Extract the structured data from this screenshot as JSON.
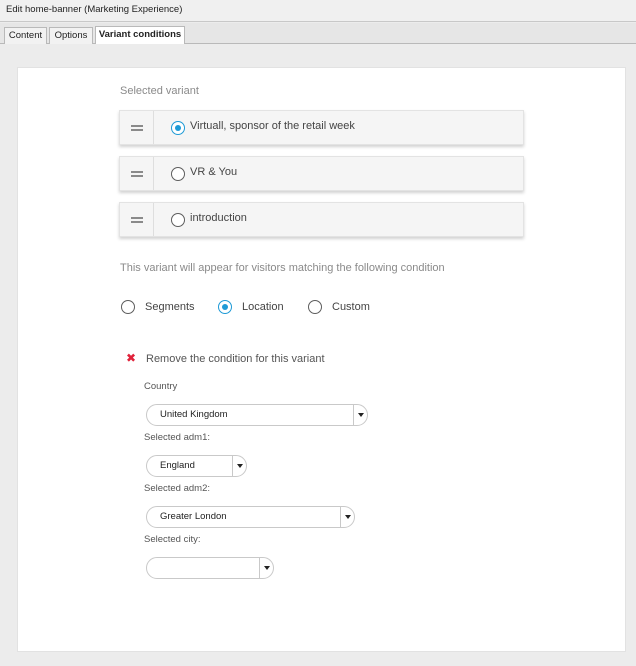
{
  "window": {
    "title": "Edit home-banner (Marketing Experience)"
  },
  "tabs": [
    {
      "label": "Content",
      "active": false
    },
    {
      "label": "Options",
      "active": false
    },
    {
      "label": "Variant conditions",
      "active": true
    }
  ],
  "variants": {
    "section_label": "Selected variant",
    "items": [
      {
        "label": "Virtuall, sponsor of the retail week",
        "selected": true
      },
      {
        "label": "VR & You",
        "selected": false
      },
      {
        "label": "introduction",
        "selected": false
      }
    ]
  },
  "condition": {
    "description": "This variant will appear for visitors matching the following condition",
    "types": [
      {
        "label": "Segments",
        "selected": false
      },
      {
        "label": "Location",
        "selected": true
      },
      {
        "label": "Custom",
        "selected": false
      }
    ],
    "remove_label": "Remove the condition for this variant",
    "remove_icon": "close-icon"
  },
  "location": {
    "country": {
      "label": "Country",
      "value": "United Kingdom"
    },
    "adm1": {
      "label": "Selected adm1:",
      "value": "England"
    },
    "adm2": {
      "label": "Selected adm2:",
      "value": "Greater London"
    },
    "city": {
      "label": "Selected city:",
      "value": ""
    }
  },
  "colors": {
    "accent": "#1e9ad6",
    "remove": "#e0223a"
  }
}
